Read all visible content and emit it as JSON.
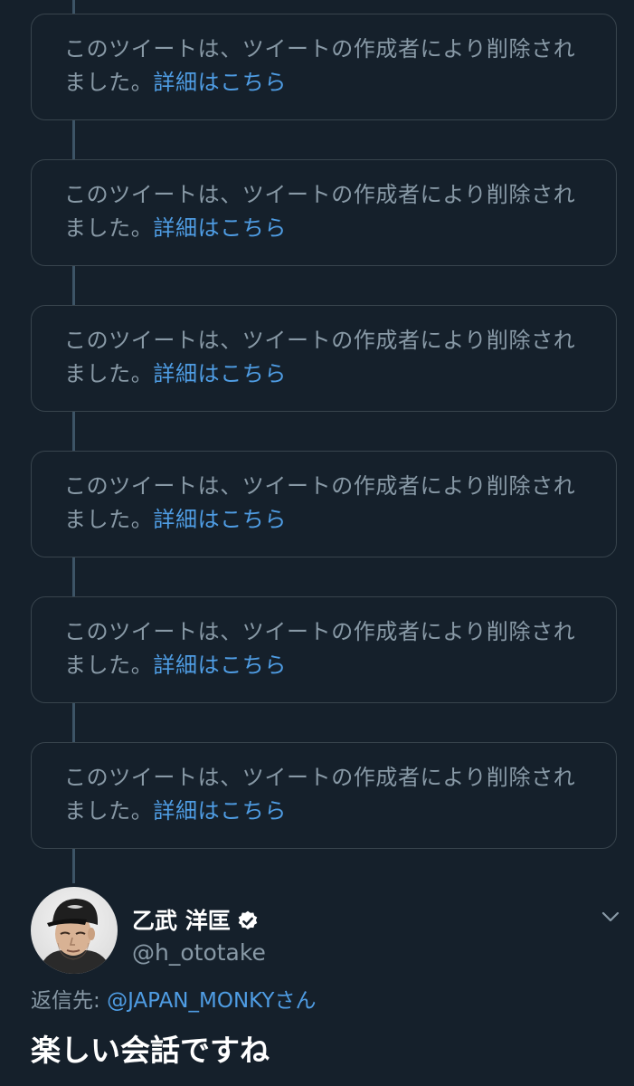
{
  "deleted_tweets": [
    {
      "text": "このツイートは、ツイートの作成者により削除されました。",
      "link": "詳細はこちら"
    },
    {
      "text": "このツイートは、ツイートの作成者により削除されました。",
      "link": "詳細はこちら"
    },
    {
      "text": "このツイートは、ツイートの作成者により削除されました。",
      "link": "詳細はこちら"
    },
    {
      "text": "このツイートは、ツイートの作成者により削除されました。",
      "link": "詳細はこちら"
    },
    {
      "text": "このツイートは、ツイートの作成者により削除されました。",
      "link": "詳細はこちら"
    },
    {
      "text": "このツイートは、ツイートの作成者により削除されました。",
      "link": "詳細はこちら"
    }
  ],
  "tweet": {
    "display_name": "乙武 洋匡",
    "handle": "@h_ototake",
    "verified_icon": "verified-badge-icon",
    "menu_icon": "chevron-down-icon",
    "reply_label": "返信先: ",
    "reply_target": "@JAPAN_MONKY",
    "reply_suffix": "さん",
    "text": "楽しい会話ですね"
  },
  "colors": {
    "background": "#15202b",
    "card_border": "#38444d",
    "muted_text": "#8899a6",
    "link": "#4f9de4",
    "thread_line": "#3d5466"
  }
}
